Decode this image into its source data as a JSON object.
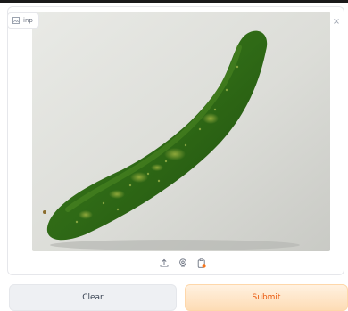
{
  "input": {
    "label": "inp",
    "label_icon": "image-icon",
    "clear_icon": "close-icon",
    "clear_glyph": "×",
    "image_subject": "cucumber",
    "toolbar_icons": [
      "upload-icon",
      "webcam-icon",
      "clipboard-icon"
    ]
  },
  "actions": {
    "clear_label": "Clear",
    "submit_label": "Submit"
  },
  "colors": {
    "submit_text": "#ea580c",
    "submit_bg": "#fde2c2",
    "clear_bg": "#eef0f3"
  }
}
